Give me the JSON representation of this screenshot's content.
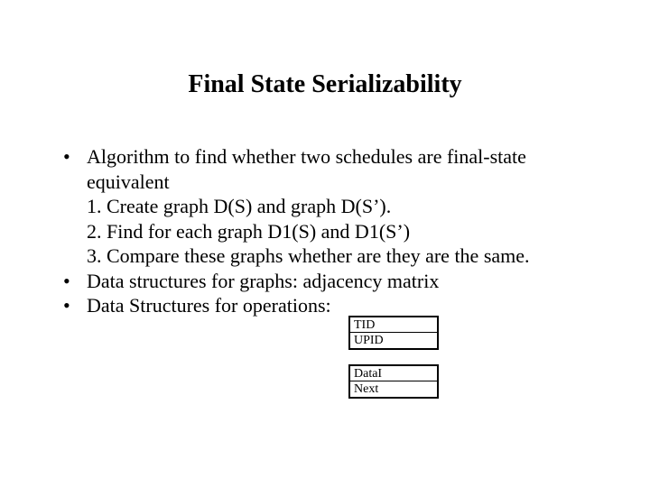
{
  "title": "Final State Serializability",
  "bullets": {
    "b1": "Algorithm to find whether two schedules are final-state equivalent",
    "b1_sub1": "1.   Create graph D(S) and graph D(S’).",
    "b1_sub2": "2. Find for each graph D1(S) and D1(S’)",
    "b1_sub3": "3. Compare these graphs whether are they are the same.",
    "b2": "Data structures for graphs: adjacency matrix",
    "b3": "Data Structures for operations:"
  },
  "table1": {
    "r1": "TID",
    "r2": "UPID"
  },
  "table2": {
    "r1": "DataI",
    "r2": "Next"
  }
}
